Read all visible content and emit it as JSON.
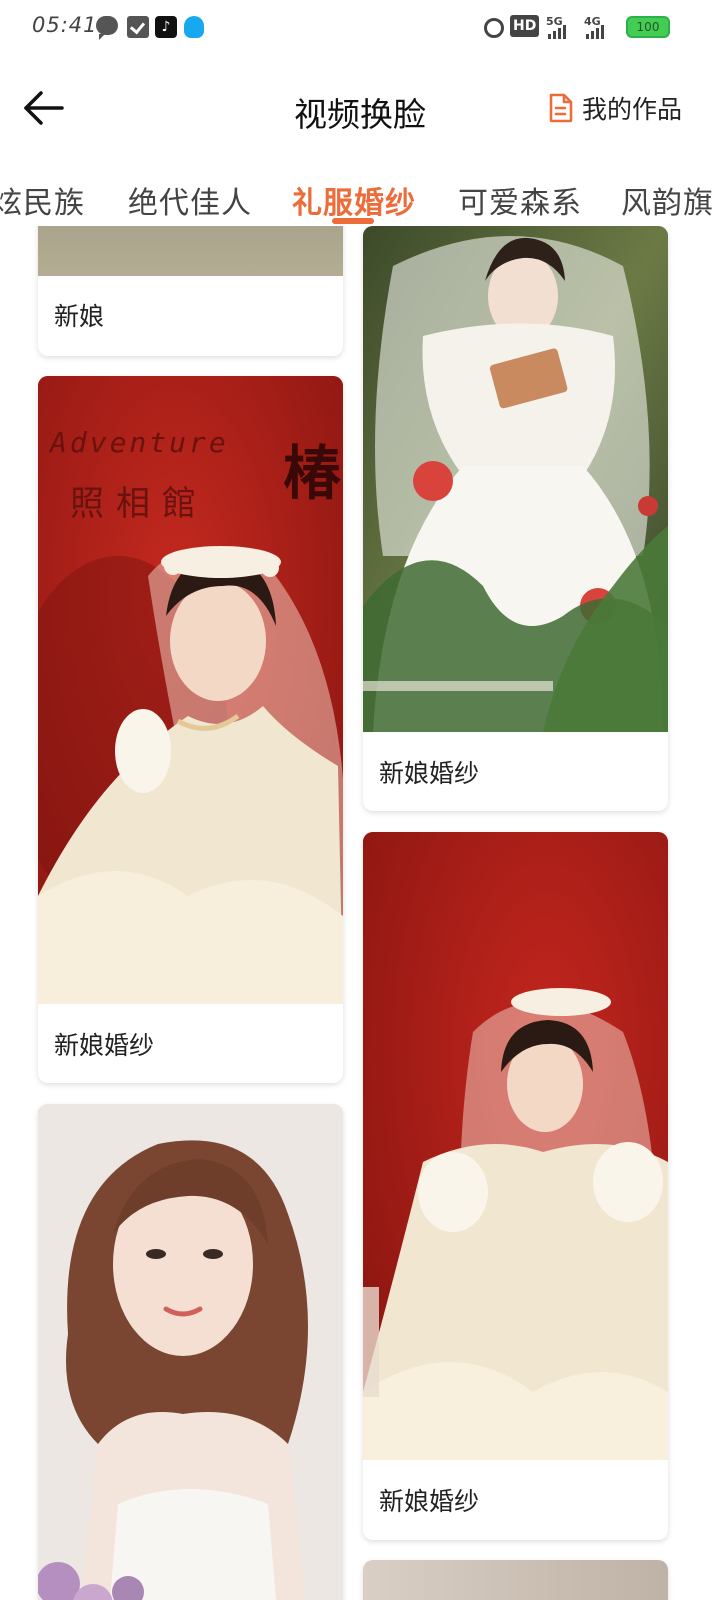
{
  "status_bar": {
    "time": "05:41",
    "icons": [
      "message-icon",
      "check-clipboard-icon",
      "tiktok-icon",
      "qq-icon",
      "alarm-icon",
      "hd-icon",
      "signal-5g-icon",
      "signal-4g-icon",
      "battery-icon"
    ],
    "hd": "HD",
    "signal_1": "5G",
    "signal_2": "4G",
    "battery": "100"
  },
  "header": {
    "title": "视频换脸",
    "my_works": "我的作品"
  },
  "tabs": [
    {
      "label": "炫民族"
    },
    {
      "label": "绝代佳人"
    },
    {
      "label": "礼服婚纱"
    },
    {
      "label": "可爱森系"
    },
    {
      "label": "风韵旗"
    }
  ],
  "cards": [
    {
      "label": "新娘"
    },
    {
      "label": "新娘婚纱"
    },
    {
      "label": "新娘婚纱"
    },
    {
      "label": "新娘婚纱"
    }
  ],
  "photo_text": {
    "sign_en": "Adventure",
    "sign_cn": "照相館",
    "sign_side": "椿"
  },
  "colors": {
    "accent": "#ec6d3a",
    "studio_red": "#b3211b"
  }
}
